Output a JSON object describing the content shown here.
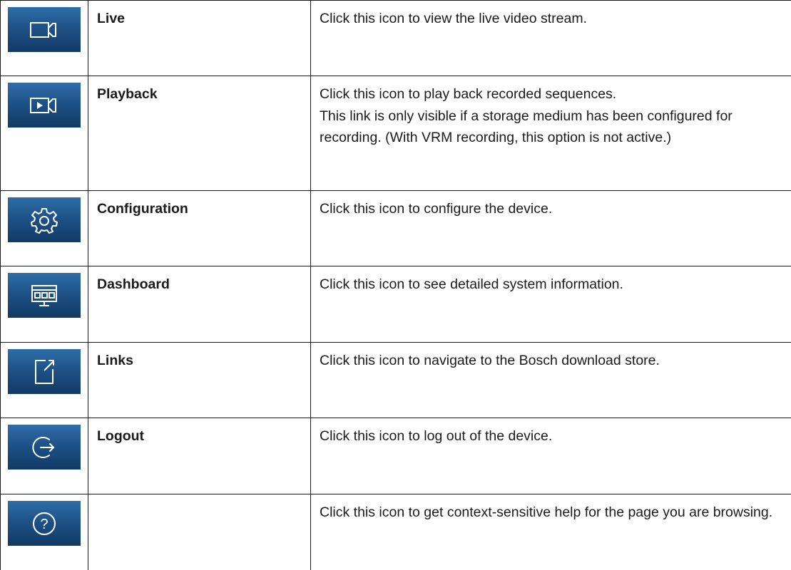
{
  "rows": [
    {
      "icon": "video-camera-icon",
      "name": "Live",
      "desc": [
        "Click this icon to view the live video stream."
      ]
    },
    {
      "icon": "playback-camera-icon",
      "name": "Playback",
      "desc": [
        "Click this icon to play back recorded sequences.",
        "This link is only visible if a storage medium has been configured for recording. (With VRM recording, this option is not active.)"
      ]
    },
    {
      "icon": "gear-icon",
      "name": "Configuration",
      "desc": [
        "Click this icon to configure the device."
      ]
    },
    {
      "icon": "dashboard-monitor-icon",
      "name": "Dashboard",
      "desc": [
        "Click this icon to see detailed system information."
      ]
    },
    {
      "icon": "external-link-icon",
      "name": "Links",
      "desc": [
        "Click this icon to navigate to the Bosch download store."
      ]
    },
    {
      "icon": "logout-icon",
      "name": "Logout",
      "desc": [
        "Click this icon to log out of the device."
      ]
    },
    {
      "icon": "help-icon",
      "name": "",
      "desc": [
        "Click this icon to get context-sensitive help for the page you are browsing."
      ]
    }
  ]
}
